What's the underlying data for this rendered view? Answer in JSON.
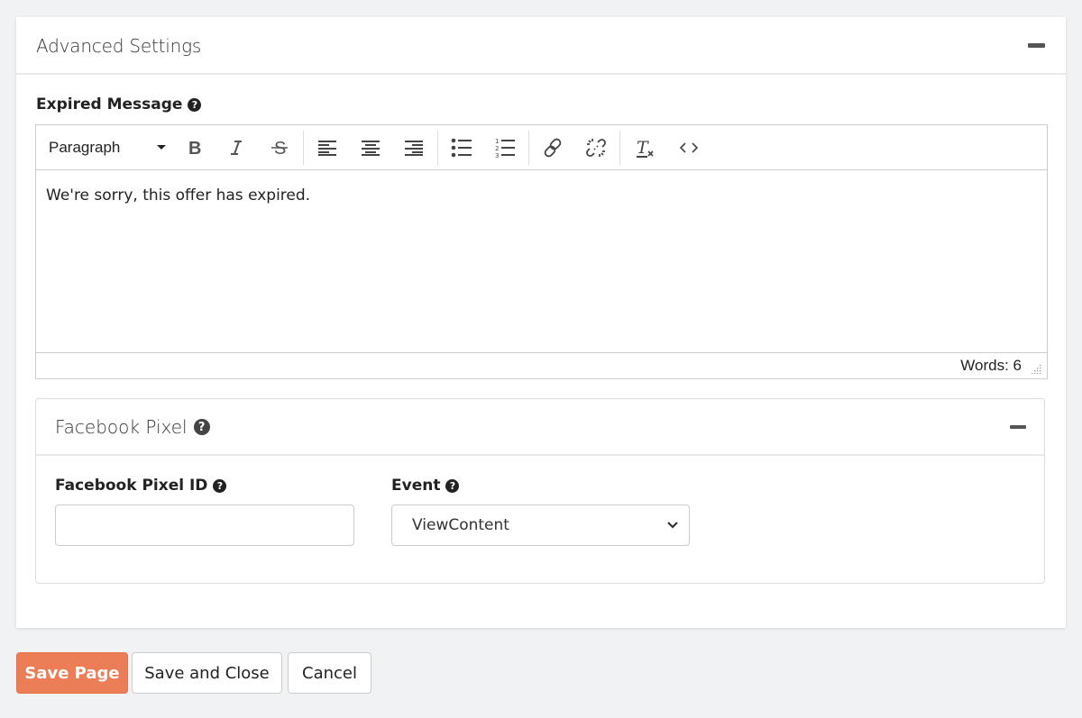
{
  "panel": {
    "title": "Advanced Settings",
    "collapse_icon": "minus-icon"
  },
  "expired_message": {
    "label": "Expired Message",
    "help_icon": "?",
    "editor": {
      "block_format": "Paragraph",
      "toolbar_buttons": [
        {
          "name": "bold",
          "icon": "bold-icon"
        },
        {
          "name": "italic",
          "icon": "italic-icon"
        },
        {
          "name": "strikethrough",
          "icon": "strikethrough-icon"
        },
        {
          "name": "align-left",
          "icon": "align-left-icon"
        },
        {
          "name": "align-center",
          "icon": "align-center-icon"
        },
        {
          "name": "align-right",
          "icon": "align-right-icon"
        },
        {
          "name": "bullet-list",
          "icon": "bullet-list-icon"
        },
        {
          "name": "numbered-list",
          "icon": "numbered-list-icon"
        },
        {
          "name": "link",
          "icon": "link-icon"
        },
        {
          "name": "unlink",
          "icon": "unlink-icon"
        },
        {
          "name": "clear-formatting",
          "icon": "clear-formatting-icon"
        },
        {
          "name": "source-code",
          "icon": "code-icon"
        }
      ],
      "content": "We're sorry, this offer has expired.",
      "word_count": "Words: 6"
    }
  },
  "facebook_pixel": {
    "title": "Facebook Pixel",
    "help_icon": "?",
    "pixel_id": {
      "label": "Facebook Pixel ID",
      "help_icon": "?",
      "value": ""
    },
    "event": {
      "label": "Event",
      "help_icon": "?",
      "selected": "ViewContent"
    }
  },
  "actions": {
    "save_page": "Save Page",
    "save_and_close": "Save and Close",
    "cancel": "Cancel"
  },
  "colors": {
    "primary": "#ec7e57",
    "background": "#f1f2f4"
  }
}
